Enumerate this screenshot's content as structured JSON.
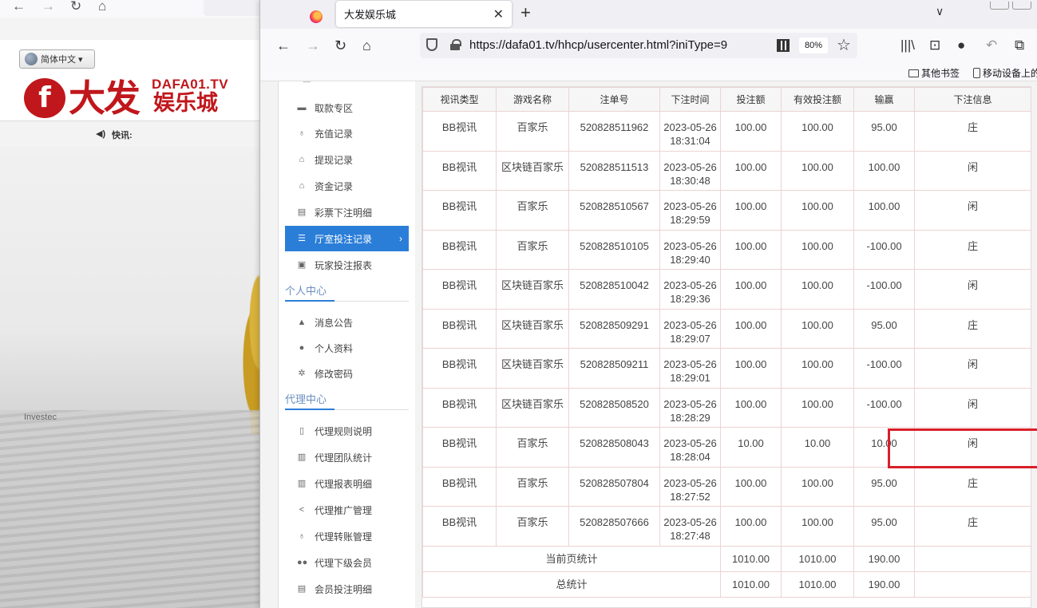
{
  "background_window": {
    "language": "简体中文 ▾",
    "logo_mark": "f",
    "logo_cn": "大发",
    "logo_domain": "DAFA01.TV",
    "logo_sub": "娱乐城",
    "news_label": "快讯:",
    "stadium_brand": "Investec"
  },
  "browser": {
    "tab_title": "大发娱乐城",
    "url": "https://dafa01.tv/hhcp/usercenter.html?iniType=9",
    "zoom": "80%",
    "bookmarks": [
      "其他书签",
      "移动设备上的"
    ]
  },
  "sidebar": {
    "items_top": [
      {
        "label": "取款专区",
        "icon": "money-icon"
      },
      {
        "label": "充值记录",
        "icon": "deposit-icon"
      },
      {
        "label": "提现记录",
        "icon": "withdraw-icon"
      },
      {
        "label": "资金记录",
        "icon": "funds-icon"
      },
      {
        "label": "彩票下注明细",
        "icon": "lottery-icon"
      },
      {
        "label": "厅室投注记录",
        "icon": "list-icon",
        "active": true
      },
      {
        "label": "玩家投注报表",
        "icon": "report-icon"
      }
    ],
    "section_personal": "个人中心",
    "items_personal": [
      {
        "label": "消息公告",
        "icon": "bell-icon"
      },
      {
        "label": "个人资料",
        "icon": "user-icon"
      },
      {
        "label": "修改密码",
        "icon": "gear-icon"
      }
    ],
    "section_agent": "代理中心",
    "items_agent": [
      {
        "label": "代理规则说明",
        "icon": "doc-icon"
      },
      {
        "label": "代理团队统计",
        "icon": "team-icon"
      },
      {
        "label": "代理报表明细",
        "icon": "report-icon"
      },
      {
        "label": "代理推广管理",
        "icon": "share-icon"
      },
      {
        "label": "代理转账管理",
        "icon": "transfer-icon"
      },
      {
        "label": "代理下级会员",
        "icon": "members-icon"
      },
      {
        "label": "会员投注明细",
        "icon": "detail-icon"
      }
    ]
  },
  "table": {
    "headers": [
      "视讯类型",
      "游戏名称",
      "注单号",
      "下注时间",
      "投注额",
      "有效投注额",
      "输赢",
      "下注信息"
    ],
    "rows": [
      {
        "type": "BB视讯",
        "game": "百家乐",
        "id": "520828511962",
        "date": "2023-05-26",
        "time": "18:31:04",
        "bet": "100.00",
        "valid": "100.00",
        "win": "95.00",
        "info": "庄"
      },
      {
        "type": "BB视讯",
        "game": "区块链百家乐",
        "id": "520828511513",
        "date": "2023-05-26",
        "time": "18:30:48",
        "bet": "100.00",
        "valid": "100.00",
        "win": "100.00",
        "info": "闲"
      },
      {
        "type": "BB视讯",
        "game": "百家乐",
        "id": "520828510567",
        "date": "2023-05-26",
        "time": "18:29:59",
        "bet": "100.00",
        "valid": "100.00",
        "win": "100.00",
        "info": "闲"
      },
      {
        "type": "BB视讯",
        "game": "百家乐",
        "id": "520828510105",
        "date": "2023-05-26",
        "time": "18:29:40",
        "bet": "100.00",
        "valid": "100.00",
        "win": "-100.00",
        "info": "庄"
      },
      {
        "type": "BB视讯",
        "game": "区块链百家乐",
        "id": "520828510042",
        "date": "2023-05-26",
        "time": "18:29:36",
        "bet": "100.00",
        "valid": "100.00",
        "win": "-100.00",
        "info": "闲"
      },
      {
        "type": "BB视讯",
        "game": "区块链百家乐",
        "id": "520828509291",
        "date": "2023-05-26",
        "time": "18:29:07",
        "bet": "100.00",
        "valid": "100.00",
        "win": "95.00",
        "info": "庄"
      },
      {
        "type": "BB视讯",
        "game": "区块链百家乐",
        "id": "520828509211",
        "date": "2023-05-26",
        "time": "18:29:01",
        "bet": "100.00",
        "valid": "100.00",
        "win": "-100.00",
        "info": "闲"
      },
      {
        "type": "BB视讯",
        "game": "区块链百家乐",
        "id": "520828508520",
        "date": "2023-05-26",
        "time": "18:28:29",
        "bet": "100.00",
        "valid": "100.00",
        "win": "-100.00",
        "info": "闲"
      },
      {
        "type": "BB视讯",
        "game": "百家乐",
        "id": "520828508043",
        "date": "2023-05-26",
        "time": "18:28:04",
        "bet": "10.00",
        "valid": "10.00",
        "win": "10.00",
        "info": "闲"
      },
      {
        "type": "BB视讯",
        "game": "百家乐",
        "id": "520828507804",
        "date": "2023-05-26",
        "time": "18:27:52",
        "bet": "100.00",
        "valid": "100.00",
        "win": "95.00",
        "info": "庄"
      },
      {
        "type": "BB视讯",
        "game": "百家乐",
        "id": "520828507666",
        "date": "2023-05-26",
        "time": "18:27:48",
        "bet": "100.00",
        "valid": "100.00",
        "win": "95.00",
        "info": "庄"
      }
    ],
    "page_total": {
      "label": "当前页统计",
      "bet": "1010.00",
      "valid": "1010.00",
      "win": "190.00"
    },
    "grand_total": {
      "label": "总统计",
      "bet": "1010.00",
      "valid": "1010.00",
      "win": "190.00"
    }
  },
  "colors": {
    "accent": "#2b7ed8",
    "highlight": "#d8202a",
    "brand": "#c0171c"
  }
}
